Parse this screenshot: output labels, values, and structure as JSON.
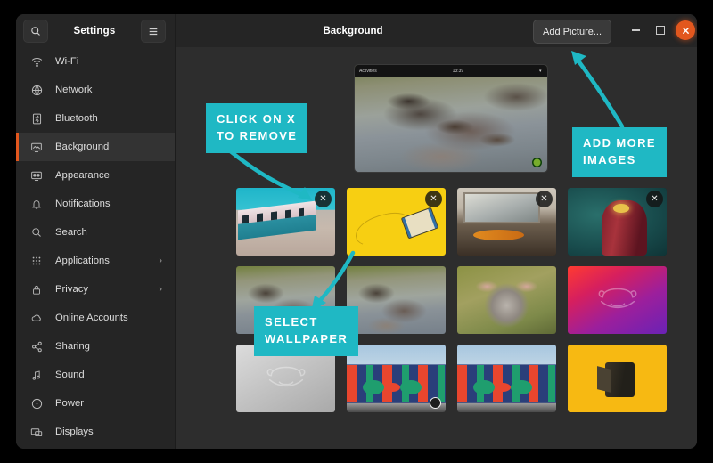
{
  "window": {
    "app_name": "Settings",
    "page_title": "Background",
    "search_icon": "search-icon",
    "menu_icon": "hamburger-menu-icon",
    "add_picture_label": "Add Picture...",
    "minimize_label": "–",
    "maximize_label": "□",
    "close_label": "×",
    "accent_color": "#e2571e"
  },
  "sidebar": {
    "items": [
      {
        "label": "Wi-Fi",
        "icon": "wifi-icon",
        "active": false,
        "chevron": ""
      },
      {
        "label": "Network",
        "icon": "network-icon",
        "active": false,
        "chevron": ""
      },
      {
        "label": "Bluetooth",
        "icon": "bluetooth-icon",
        "active": false,
        "chevron": ""
      },
      {
        "label": "Background",
        "icon": "background-icon",
        "active": true,
        "chevron": ""
      },
      {
        "label": "Appearance",
        "icon": "appearance-icon",
        "active": false,
        "chevron": ""
      },
      {
        "label": "Notifications",
        "icon": "notifications-icon",
        "active": false,
        "chevron": ""
      },
      {
        "label": "Search",
        "icon": "search-icon",
        "active": false,
        "chevron": ""
      },
      {
        "label": "Applications",
        "icon": "applications-icon",
        "active": false,
        "chevron": "›"
      },
      {
        "label": "Privacy",
        "icon": "lock-icon",
        "active": false,
        "chevron": "›"
      },
      {
        "label": "Online Accounts",
        "icon": "cloud-icon",
        "active": false,
        "chevron": ""
      },
      {
        "label": "Sharing",
        "icon": "share-icon",
        "active": false,
        "chevron": ""
      },
      {
        "label": "Sound",
        "icon": "sound-icon",
        "active": false,
        "chevron": ""
      },
      {
        "label": "Power",
        "icon": "power-icon",
        "active": false,
        "chevron": ""
      },
      {
        "label": "Displays",
        "icon": "displays-icon",
        "active": false,
        "chevron": ""
      }
    ]
  },
  "preview": {
    "name": "desktop-preview",
    "topbar_left": "Activities",
    "topbar_clock": "13:39",
    "topbar_right": "▾",
    "wallpaper": "hippos-in-water"
  },
  "wallpapers": {
    "remove_glyph": "✕",
    "rows": [
      [
        {
          "name": "train-station",
          "art": "art-train",
          "removable": true,
          "selected": false
        },
        {
          "name": "yellow-cassette",
          "art": "art-cassette",
          "removable": true,
          "selected": false
        },
        {
          "name": "desk-record-player",
          "art": "art-desk",
          "removable": true,
          "selected": false
        },
        {
          "name": "red-dalek",
          "art": "art-dalek",
          "removable": true,
          "selected": false
        }
      ],
      [
        {
          "name": "hippos-group-a",
          "art": "art-hippos1",
          "removable": false,
          "selected": true
        },
        {
          "name": "hippos-group-b",
          "art": "art-hippos2",
          "removable": false,
          "selected": false
        },
        {
          "name": "hippo-face",
          "art": "art-hippoface",
          "removable": false,
          "selected": false
        },
        {
          "name": "purple-hippo-logo",
          "art": "art-gradient-purple",
          "removable": false,
          "selected": false,
          "logo": true
        }
      ],
      [
        {
          "name": "gray-hippo-logo",
          "art": "art-gray",
          "removable": false,
          "selected": false,
          "logo": true
        },
        {
          "name": "mural-wall-a",
          "art": "art-mural",
          "removable": false,
          "selected": true
        },
        {
          "name": "mural-wall-b",
          "art": "art-mural",
          "removable": false,
          "selected": false
        },
        {
          "name": "film-canister",
          "art": "art-film",
          "removable": false,
          "selected": false
        }
      ]
    ]
  },
  "annotations": {
    "color": "#1fb8c4",
    "remove": "CLICK ON X\nTO REMOVE",
    "add": "ADD MORE\nIMAGES",
    "select": "SELECT\nWALLPAPER"
  }
}
